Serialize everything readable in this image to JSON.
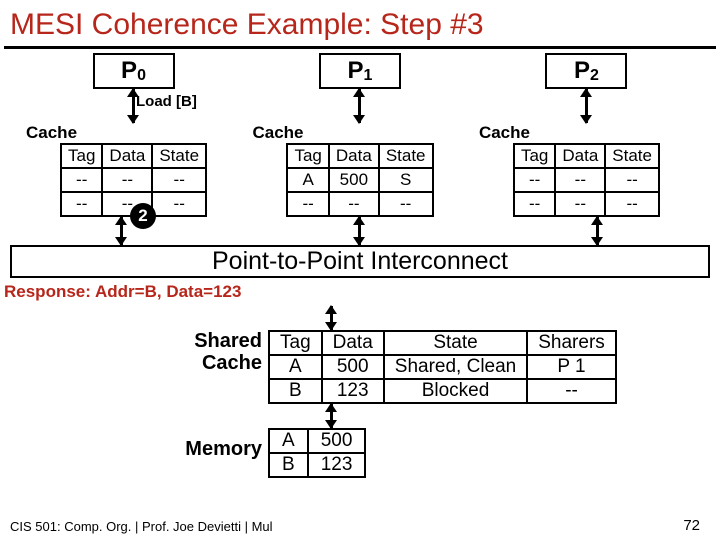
{
  "title": "MESI Coherence Example: Step #3",
  "load_label": "Load [B]",
  "cache_word": "Cache",
  "cache_headers": {
    "tag": "Tag",
    "data": "Data",
    "state": "State"
  },
  "procs": [
    {
      "name": "P",
      "sub": "0",
      "rows": [
        {
          "t": "--",
          "d": "--",
          "s": "--"
        },
        {
          "t": "--",
          "d": "--",
          "s": "--"
        }
      ]
    },
    {
      "name": "P",
      "sub": "1",
      "rows": [
        {
          "t": "A",
          "d": "500",
          "s": "S"
        },
        {
          "t": "--",
          "d": "--",
          "s": "--"
        }
      ]
    },
    {
      "name": "P",
      "sub": "2",
      "rows": [
        {
          "t": "--",
          "d": "--",
          "s": "--"
        },
        {
          "t": "--",
          "d": "--",
          "s": "--"
        }
      ]
    }
  ],
  "step_badge": "2",
  "interconnect": "Point-to-Point Interconnect",
  "response": "Response: Addr=B, Data=123",
  "shared_label_l1": "Shared",
  "shared_label_l2": "Cache",
  "shared_headers": {
    "tag": "Tag",
    "data": "Data",
    "state": "State",
    "sharers": "Sharers"
  },
  "shared_rows": [
    {
      "t": "A",
      "d": "500",
      "s": "Shared, Clean",
      "sh": "P 1"
    },
    {
      "t": "B",
      "d": "123",
      "s": "Blocked",
      "sh": "--"
    }
  ],
  "memory_label": "Memory",
  "memory_rows": [
    {
      "t": "A",
      "d": "500"
    },
    {
      "t": "B",
      "d": "123"
    }
  ],
  "footer": "CIS 501: Comp. Org. | Prof. Joe Devietti | Mul",
  "pagenum": "72"
}
